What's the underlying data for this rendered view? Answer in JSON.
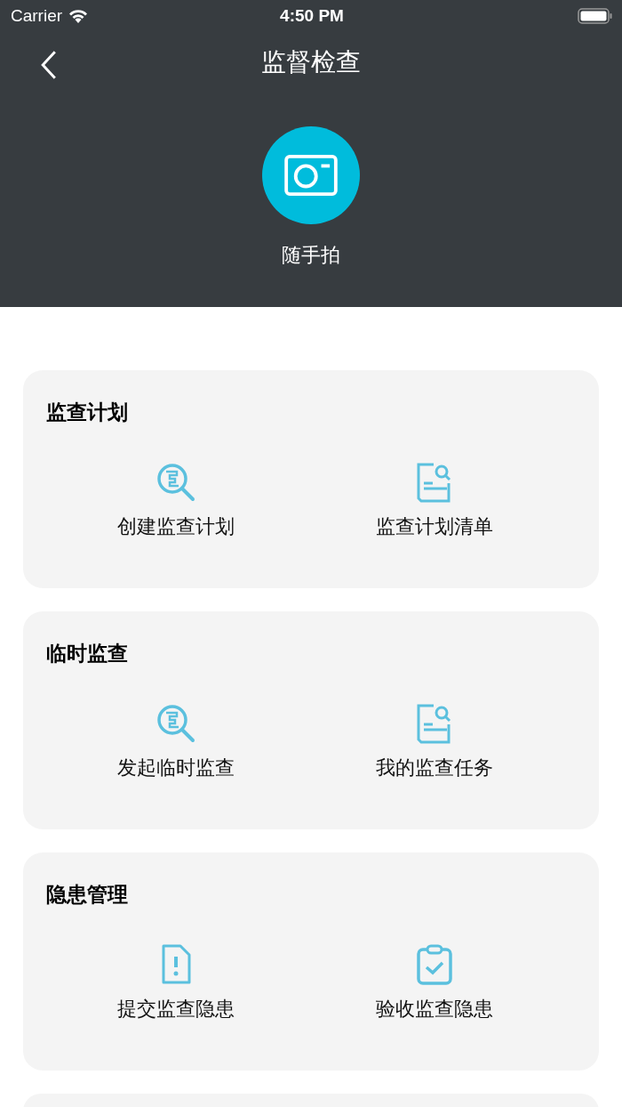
{
  "status_bar": {
    "carrier": "Carrier",
    "time": "4:50 PM"
  },
  "nav": {
    "title": "监督检查"
  },
  "quick_action": {
    "label": "随手拍"
  },
  "sections": [
    {
      "title": "监查计划",
      "items": [
        {
          "label": "创建监查计划",
          "kind": "magnifier"
        },
        {
          "label": "监查计划清单",
          "kind": "doc-search"
        }
      ]
    },
    {
      "title": "临时监查",
      "items": [
        {
          "label": "发起临时监查",
          "kind": "magnifier"
        },
        {
          "label": "我的监查任务",
          "kind": "doc-search"
        }
      ]
    },
    {
      "title": "隐患管理",
      "items": [
        {
          "label": "提交监查隐患",
          "kind": "doc-alert"
        },
        {
          "label": "验收监查隐患",
          "kind": "clipboard-check"
        }
      ]
    }
  ]
}
